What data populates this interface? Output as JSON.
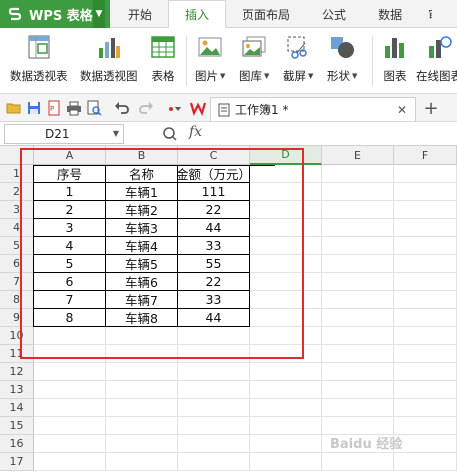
{
  "app": {
    "name": "WPS 表格"
  },
  "menu_tabs": [
    "开始",
    "插入",
    "页面布局",
    "公式",
    "数据",
    "审"
  ],
  "active_tab_index": 1,
  "ribbon": {
    "buttons": [
      {
        "label": "数据透视表",
        "icon": "pivot-table-icon",
        "has_dropdown": false
      },
      {
        "label": "数据透视图",
        "icon": "pivot-chart-icon",
        "has_dropdown": false
      },
      {
        "label": "表格",
        "icon": "table-icon",
        "has_dropdown": false
      },
      {
        "label": "图片",
        "icon": "picture-icon",
        "has_dropdown": true
      },
      {
        "label": "图库",
        "icon": "gallery-icon",
        "has_dropdown": true
      },
      {
        "label": "截屏",
        "icon": "screenshot-icon",
        "has_dropdown": true
      },
      {
        "label": "形状",
        "icon": "shape-icon",
        "has_dropdown": true
      },
      {
        "label": "图表",
        "icon": "chart-icon",
        "has_dropdown": false
      },
      {
        "label": "在线图表",
        "icon": "online-chart-icon",
        "has_dropdown": false
      }
    ]
  },
  "document_tab": {
    "title": "工作簿1 *"
  },
  "formula_bar": {
    "name_box": "D21",
    "fx_label": "fx",
    "formula": ""
  },
  "columns": [
    "A",
    "B",
    "C",
    "D",
    "E",
    "F"
  ],
  "selected_column": "D",
  "rows": [
    "1",
    "2",
    "3",
    "4",
    "5",
    "6",
    "7",
    "8",
    "9",
    "10",
    "11",
    "12",
    "13",
    "14",
    "15",
    "16",
    "17"
  ],
  "sheet_table": {
    "headers": [
      "序号",
      "名称",
      "金额（万元）"
    ],
    "rows": [
      [
        "1",
        "车辆1",
        "111"
      ],
      [
        "2",
        "车辆2",
        "22"
      ],
      [
        "3",
        "车辆3",
        "44"
      ],
      [
        "4",
        "车辆4",
        "33"
      ],
      [
        "5",
        "车辆5",
        "55"
      ],
      [
        "6",
        "车辆6",
        "22"
      ],
      [
        "7",
        "车辆7",
        "33"
      ],
      [
        "8",
        "车辆8",
        "44"
      ]
    ]
  },
  "colors": {
    "brand_green": "#3f9b3f",
    "highlight_red": "#e02b2b"
  },
  "watermark": "Baidu 经验"
}
